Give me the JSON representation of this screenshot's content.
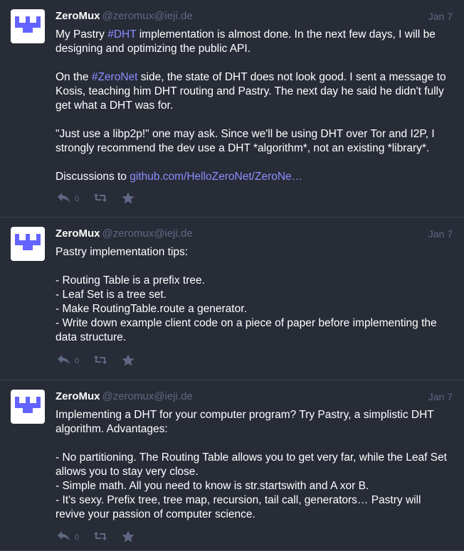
{
  "posts": [
    {
      "display_name": "ZeroMux",
      "handle": "@zeromux@ieji.de",
      "date": "Jan 7",
      "reply_count": "0",
      "p1_a": "My Pastry ",
      "p1_tag": "#DHT",
      "p1_b": " implementation is almost done. In the next few days, I will be designing and optimizing the public API.",
      "p2_a": "On the ",
      "p2_tag": "#ZeroNet",
      "p2_b": " side, the state of DHT does not look good. I sent a message to Kosis, teaching him DHT routing and Pastry. The next day he said he didn't fully get what a DHT was for.",
      "p3": "\"Just use a libp2p!\" one may ask. Since we'll be using DHT over Tor and I2P, I strongly recommend the dev use a DHT *algorithm*, not an existing *library*.",
      "p4_a": "Discussions to ",
      "p4_link": "github.com/HelloZeroNet/ZeroNe…"
    },
    {
      "display_name": "ZeroMux",
      "handle": "@zeromux@ieji.de",
      "date": "Jan 7",
      "reply_count": "0",
      "intro": "Pastry implementation tips:",
      "lines": [
        "- Routing Table is a prefix tree.",
        "- Leaf Set is a tree set.",
        "- Make RoutingTable.route a generator.",
        "- Write down example client code on a piece of paper before implementing the data structure."
      ]
    },
    {
      "display_name": "ZeroMux",
      "handle": "@zeromux@ieji.de",
      "date": "Jan 7",
      "reply_count": "0",
      "intro": "Implementing a DHT for your computer program? Try Pastry, a simplistic DHT algorithm. Advantages:",
      "lines": [
        "- No partitioning. The Routing Table allows you to get very far, while the Leaf Set allows you to stay very close.",
        "- Simple math. All you need to know is str.startswith and A xor B.",
        "- It's sexy. Prefix tree, tree map, recursion, tail call, generators… Pastry will revive your passion of computer science."
      ]
    }
  ],
  "icons": {
    "reply": "reply-icon",
    "boost": "boost-icon",
    "favourite": "star-icon",
    "avatar": "zeromux-logo"
  },
  "colors": {
    "background": "#282c37",
    "text": "#ffffff",
    "muted": "#606984",
    "link": "#8c8dff",
    "divider": "#393f4f",
    "logo": "#6364ff"
  }
}
